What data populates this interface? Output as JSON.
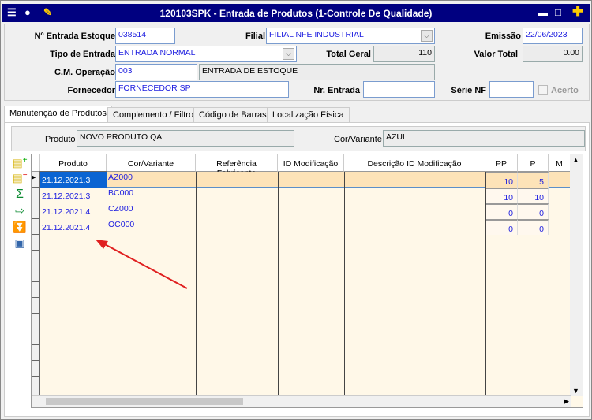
{
  "window": {
    "title": "120103SPK - Entrada de Produtos (1-Controle De Qualidade)"
  },
  "form": {
    "entrada_label": "Nº Entrada Estoque",
    "entrada_value": "038514",
    "filial_label": "Filial",
    "filial_value": "FILIAL NFE INDUSTRIAL",
    "emissao_label": "Emissão",
    "emissao_value": "22/06/2023",
    "tipo_label": "Tipo de Entrada",
    "tipo_value": "ENTRADA NORMAL",
    "total_geral_label": "Total Geral",
    "total_geral_value": "110",
    "valor_total_label": "Valor Total",
    "valor_total_value": "0.00",
    "cm_label": "C.M. Operação",
    "cm_value": "003",
    "cm_desc": "ENTRADA DE ESTOQUE",
    "fornecedor_label": "Fornecedor",
    "fornecedor_value": "FORNECEDOR SP",
    "nr_entrada_label": "Nr. Entrada",
    "nr_entrada_value": "",
    "serie_label": "Série NF",
    "serie_value": "",
    "acerto_label": "Acerto"
  },
  "tabs": [
    "Manutenção de Produtos",
    "Complemento / Filtros",
    "Código de Barras",
    "Localização Física"
  ],
  "sub": {
    "produto_label": "Produto",
    "produto_value": "NOVO PRODUTO QA",
    "cor_label": "Cor/Variante",
    "cor_value": "AZUL"
  },
  "side_icons": [
    "add-row-icon",
    "delete-row-icon",
    "sum-icon",
    "export-icon",
    "download-icon",
    "image-icon"
  ],
  "grid": {
    "headers": [
      "Produto",
      "Cor/Variante",
      "Referência Fabricante",
      "ID Modificação",
      "Descrição ID Modificação",
      "PP",
      "P",
      "M"
    ],
    "rows": [
      [
        "21.12.2021.3",
        "AZ000",
        "",
        "",
        "",
        "10",
        "5"
      ],
      [
        "21.12.2021.3",
        "BC000",
        "",
        "",
        "",
        "10",
        "10"
      ],
      [
        "21.12.2021.4",
        "CZ000",
        "",
        "",
        "",
        "0",
        "0"
      ],
      [
        "21.12.2021.4",
        "OC000",
        "",
        "",
        "",
        "0",
        "0"
      ]
    ]
  },
  "colors": {
    "titlebar": "#000080",
    "selected_row": "#fde3b8",
    "text_value": "#2020e0",
    "arrow": "#e02020"
  }
}
